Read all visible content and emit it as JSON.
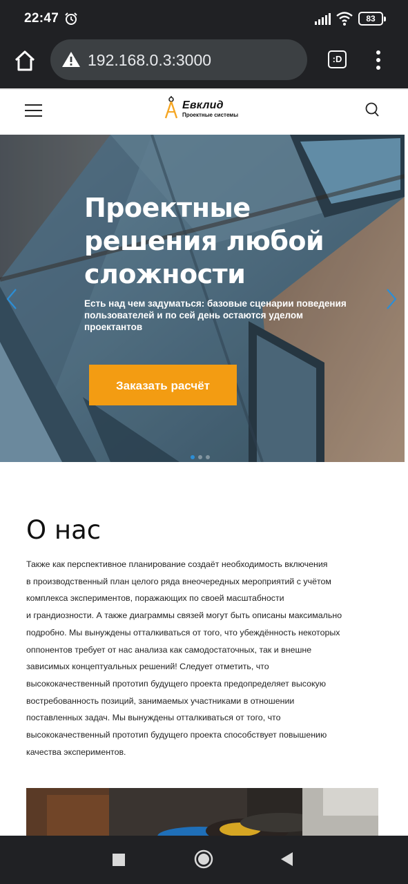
{
  "status_bar": {
    "time": "22:47",
    "battery": "83",
    "icons": [
      "alarm-icon",
      "signal-icon",
      "wifi-icon",
      "battery-icon"
    ]
  },
  "browser": {
    "url": "192.168.0.3:3000",
    "tab_switcher_label": ":D",
    "icons": [
      "home-icon",
      "not-secure-warning-icon",
      "tab-switcher-icon",
      "more-menu-icon"
    ]
  },
  "site_header": {
    "logo_name": "Евклид",
    "logo_tagline": "Проектные системы",
    "icons": [
      "hamburger-menu-icon",
      "compass-logo-icon",
      "search-icon"
    ]
  },
  "hero": {
    "title": "Проектные решения любой сложности",
    "subtitle": "Есть над чем задуматься: базовые сценарии поведения пользователей и по сей день остаются уделом проектантов",
    "cta_label": "Заказать расчёт",
    "slide_count": 3,
    "active_slide": 1,
    "accent_color": "#f39c12",
    "arrow_color": "#2c8ed6"
  },
  "about": {
    "title": "О нас",
    "lines": [
      "Также как перспективное планирование создаёт необходимость включения",
      "в производственный план целого ряда внеочередных мероприятий с учётом",
      "комплекса экспериментов, поражающих по своей масштабности",
      "и грандиозности. А также диаграммы связей могут быть описаны максимально",
      "подробно. Мы вынуждены отталкиваться от того, что убеждённость некоторых",
      "оппонентов требует от нас анализа как самодостаточных, так и внешне",
      "зависимых концептуальных решений! Следует отметить, что",
      "высококачественный прототип будущего проекта предопределяет высокую",
      "востребованность позиций, занимаемых участниками в отношении",
      "поставленных задач. Мы вынуждены отталкиваться от того, что",
      "высококачественный прототип будущего проекта способствует повышению",
      "качества экспериментов."
    ]
  },
  "android_nav": {
    "icons": [
      "recents-icon",
      "home-circle-icon",
      "back-icon"
    ]
  }
}
